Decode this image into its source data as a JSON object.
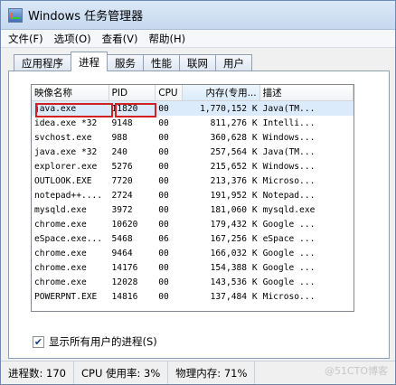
{
  "window": {
    "title": "Windows 任务管理器"
  },
  "menu": [
    "文件(F)",
    "选项(O)",
    "查看(V)",
    "帮助(H)"
  ],
  "tabs": [
    "应用程序",
    "进程",
    "服务",
    "性能",
    "联网",
    "用户"
  ],
  "columns": [
    "映像名称",
    "PID",
    "CPU",
    "内存(专用...",
    "描述"
  ],
  "rows": [
    [
      "java.exe",
      "11820",
      "00",
      "1,770,152 K",
      "Java(TM..."
    ],
    [
      "idea.exe *32",
      "9148",
      "00",
      "811,276 K",
      "Intelli..."
    ],
    [
      "svchost.exe",
      "988",
      "00",
      "360,628 K",
      "Windows..."
    ],
    [
      "java.exe *32",
      "240",
      "00",
      "257,564 K",
      "Java(TM..."
    ],
    [
      "explorer.exe",
      "5276",
      "00",
      "215,652 K",
      "Windows..."
    ],
    [
      "OUTLOOK.EXE",
      "7720",
      "00",
      "213,376 K",
      "Microso..."
    ],
    [
      "notepad++....",
      "2724",
      "00",
      "191,952 K",
      "Notepad..."
    ],
    [
      "mysqld.exe",
      "3972",
      "00",
      "181,060 K",
      "mysqld.exe"
    ],
    [
      "chrome.exe",
      "10620",
      "00",
      "179,432 K",
      "Google ..."
    ],
    [
      "eSpace.exe...",
      "5468",
      "06",
      "167,256 K",
      "eSpace ..."
    ],
    [
      "chrome.exe",
      "9464",
      "00",
      "166,032 K",
      "Google ..."
    ],
    [
      "chrome.exe",
      "14176",
      "00",
      "154,388 K",
      "Google ..."
    ],
    [
      "chrome.exe",
      "12028",
      "00",
      "143,536 K",
      "Google ..."
    ],
    [
      "POWERPNT.EXE",
      "14816",
      "00",
      "137,484 K",
      "Microso..."
    ]
  ],
  "show_all": {
    "label": "显示所有用户的进程(S)",
    "checked": true
  },
  "status": {
    "processes": "进程数: 170",
    "cpu": "CPU 使用率: 3%",
    "memory": "物理内存: 71%"
  },
  "watermark": "@51CTO博客"
}
